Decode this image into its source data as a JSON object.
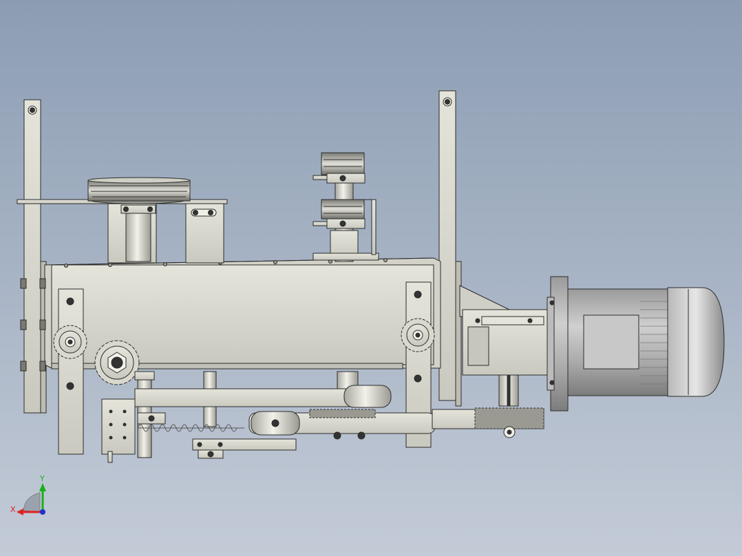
{
  "viewport": {
    "background_top": "#8c9db3",
    "background_bottom": "#c3cbd7"
  },
  "colors": {
    "part_fill": "#dcdcd2",
    "part_shade": "#bdbdb3",
    "edge": "#2b2b2b",
    "motor_fill": "#b4b4b4",
    "motor_dark": "#8a8a8a"
  },
  "triad": {
    "x_label": "X",
    "y_label": "Y",
    "x_color": "#e02020",
    "y_color": "#18b018",
    "z_color": "#2030d0"
  }
}
